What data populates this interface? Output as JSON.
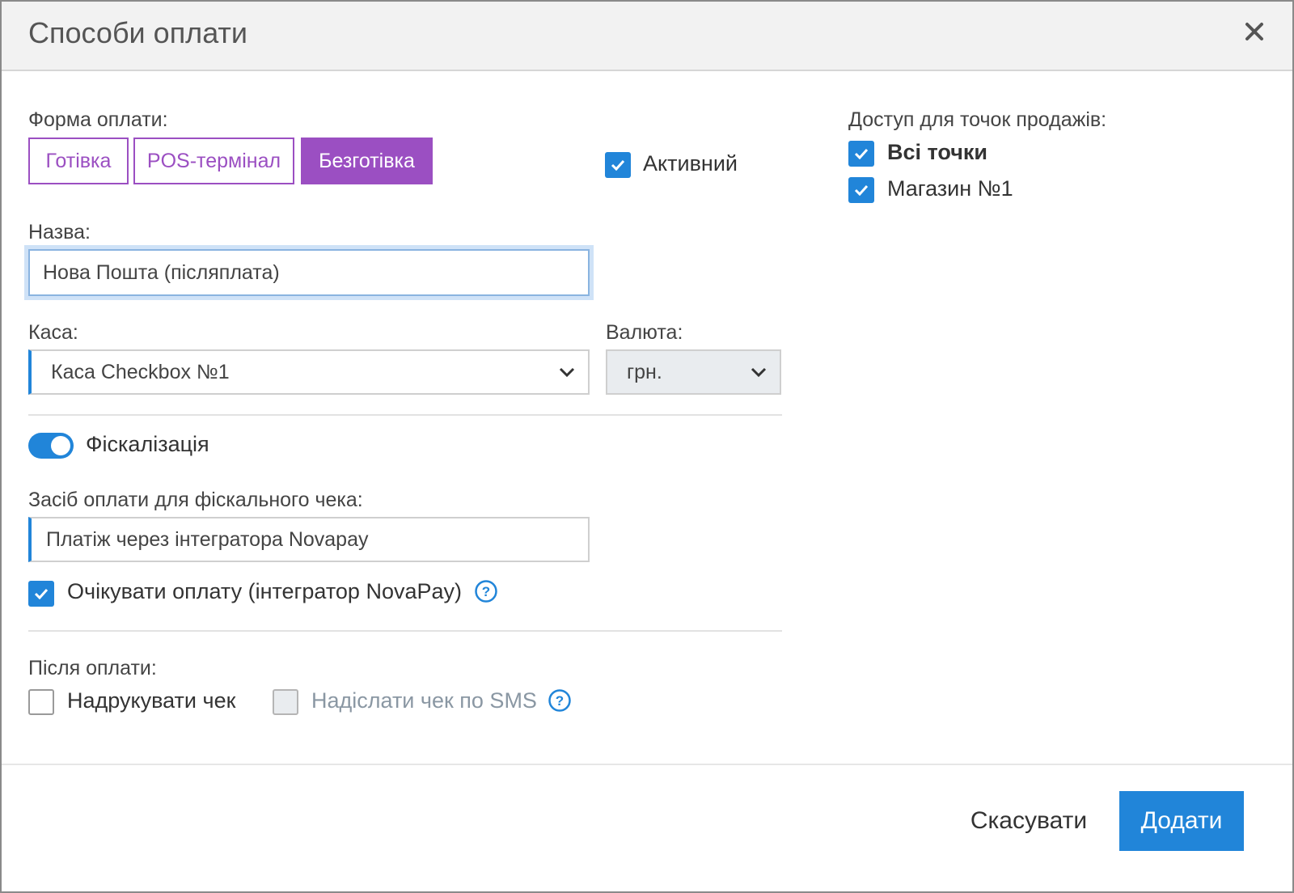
{
  "modal": {
    "title": "Способи оплати"
  },
  "payment_form": {
    "label": "Форма оплати:",
    "options": [
      "Готівка",
      "POS-термінал",
      "Безготівка"
    ],
    "selected": "Безготівка"
  },
  "active": {
    "label": "Активний",
    "checked": true
  },
  "name": {
    "label": "Назва:",
    "value": "Нова Пошта (післяплата)"
  },
  "cashbox": {
    "label": "Каса:",
    "value": "Каса Checkbox №1"
  },
  "currency": {
    "label": "Валюта:",
    "value": "грн."
  },
  "fiscalization": {
    "label": "Фіскалізація",
    "enabled": true
  },
  "fiscal_payment": {
    "label": "Засіб оплати для фіскального чека:",
    "value": "Платіж через інтегратора Novapay"
  },
  "await_payment": {
    "label": "Очікувати оплату (інтегратор NovaPay)",
    "checked": true
  },
  "after_payment": {
    "label": "Після оплати:",
    "print_receipt": {
      "label": "Надрукувати чек",
      "checked": false
    },
    "send_sms": {
      "label": "Надіслати чек по SMS",
      "checked": false,
      "disabled": true
    }
  },
  "access": {
    "label": "Доступ для точок продажів:",
    "points": [
      {
        "label": "Всі точки",
        "checked": true
      },
      {
        "label": "Магазин №1",
        "checked": true
      }
    ]
  },
  "footer": {
    "cancel_label": "Скасувати",
    "add_label": "Додати"
  },
  "colors": {
    "accent": "#2185d9",
    "payment_purple": "#9b4fc2",
    "header_bg": "#f2f2f2"
  }
}
